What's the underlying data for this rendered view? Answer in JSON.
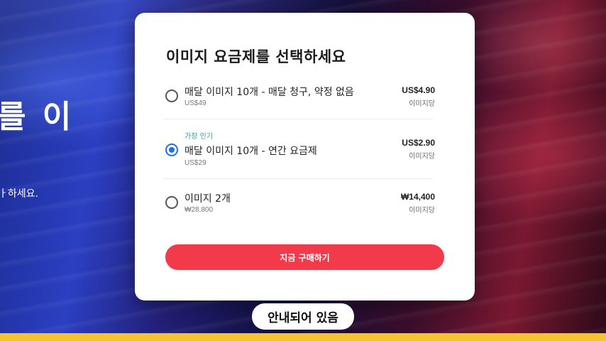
{
  "background": {
    "heading": "를 이",
    "subtext": "ㅏ하세요."
  },
  "modal": {
    "title": "이미지 요금제를 선택하세요",
    "plans": [
      {
        "badge": "",
        "name": "매달 이미지 10개 - 매달 청구, 약정 없음",
        "total": "US$49",
        "price": "US$4.90",
        "per_unit": "이미지당",
        "selected": false
      },
      {
        "badge": "가장 인기",
        "name": "매달 이미지 10개 - 연간 요금제",
        "total": "US$29",
        "price": "US$2.90",
        "per_unit": "이미지당",
        "selected": true
      },
      {
        "badge": "",
        "name": "이미지 2개",
        "total": "₩28,800",
        "price": "₩14,400",
        "per_unit": "이미지당",
        "selected": false
      }
    ],
    "buy_label": "지금 구매하기"
  },
  "caption": "안내되어 있음",
  "colors": {
    "accent_button": "#f23a4b",
    "radio_selected": "#1f6fe0",
    "badge_text": "#2aa3a8",
    "bottom_bar": "#f5c430"
  }
}
